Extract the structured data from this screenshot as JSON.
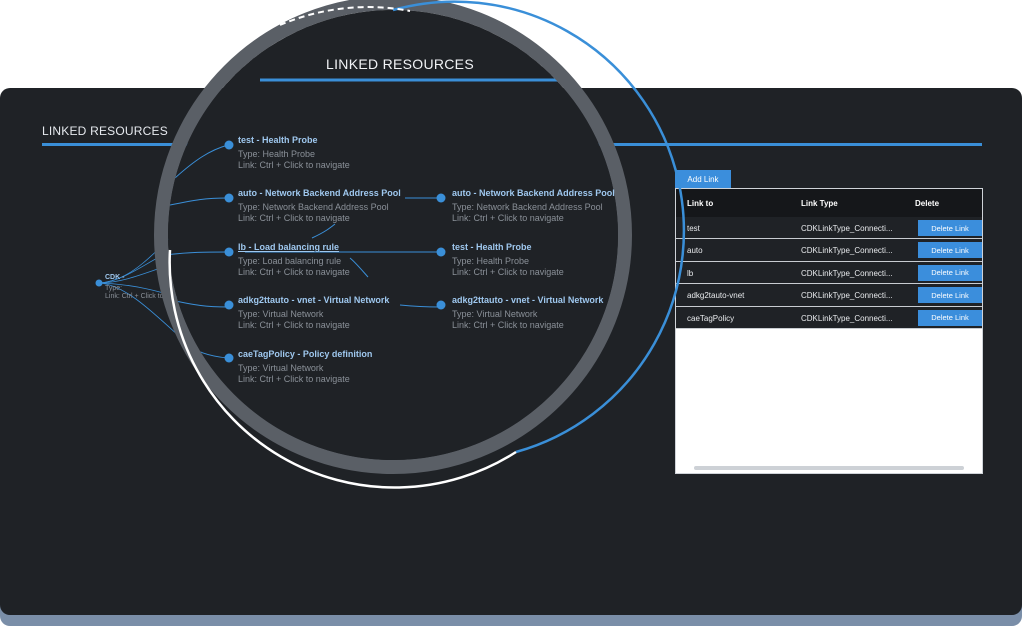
{
  "panel": {
    "title": "LINKED RESOURCES"
  },
  "magnifier": {
    "title": "LINKED RESOURCES"
  },
  "root": {
    "title": "CDK -",
    "type": "Type:",
    "link": "Link: Ctrl + Click to na"
  },
  "graph": {
    "nodes": [
      {
        "title": "test - Health Probe",
        "type": "Type: Health Probe",
        "link": "Link: Ctrl + Click to navigate"
      },
      {
        "title": "auto - Network Backend Address Pool",
        "type": "Type: Network Backend Address Pool",
        "link": "Link: Ctrl + Click to navigate"
      },
      {
        "title": "auto - Network Backend Address Pool",
        "type": "Type: Network Backend Address Pool",
        "link": "Link: Ctrl + Click to navigate"
      },
      {
        "title": "lb - Load balancing rule",
        "type": "Type: Load balancing rule",
        "link": "Link: Ctrl + Click to navigate"
      },
      {
        "title": "test - Health Probe",
        "type": "Type: Health Probe",
        "link": "Link: Ctrl + Click to navigate"
      },
      {
        "title": "adkg2ttauto - vnet - Virtual Network",
        "type": "Type: Virtual Network",
        "link": "Link: Ctrl + Click to navigate"
      },
      {
        "title": "adkg2ttauto - vnet - Virtual Network",
        "type": "Type: Virtual Network",
        "link": "Link: Ctrl + Click to navigate"
      },
      {
        "title": "caeTagPolicy - Policy definition",
        "type": "Type: Virtual Network",
        "link": "Link: Ctrl + Click to navigate"
      }
    ]
  },
  "table": {
    "add_link_label": "Add Link",
    "headers": [
      "Link to",
      "Link Type",
      "Delete"
    ],
    "delete_label": "Delete Link",
    "rows": [
      {
        "link_to": "test",
        "link_type": "CDKLinkType_Connecti..."
      },
      {
        "link_to": "auto",
        "link_type": "CDKLinkType_Connecti..."
      },
      {
        "link_to": "lb",
        "link_type": "CDKLinkType_Connecti..."
      },
      {
        "link_to": "adkg2tauto-vnet",
        "link_type": "CDKLinkType_Connecti..."
      },
      {
        "link_to": "caeTagPolicy",
        "link_type": "CDKLinkType_Connecti..."
      }
    ]
  },
  "colors": {
    "accent": "#3b8edc",
    "panel": "#1f2226",
    "link_text": "#9fc8ef"
  }
}
